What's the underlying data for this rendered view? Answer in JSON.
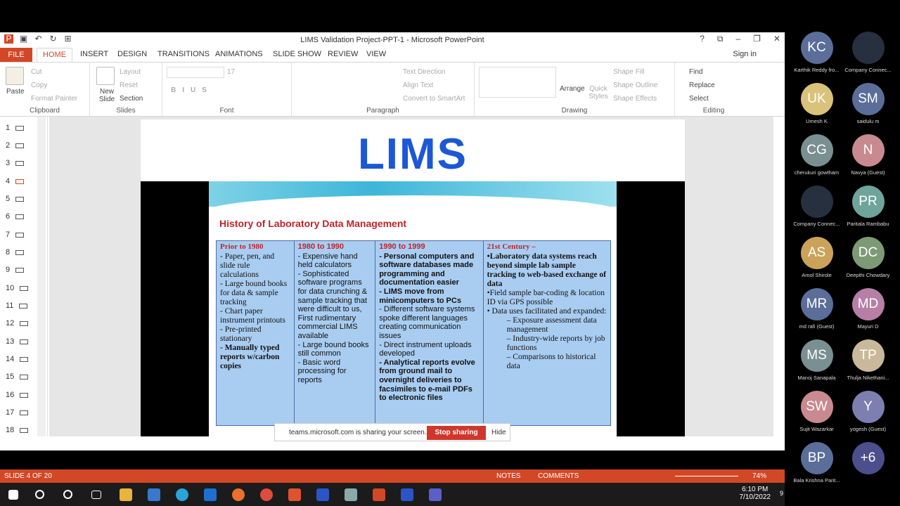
{
  "window": {
    "title": "LIMS Validation Project-PPT-1 - Microsoft PowerPoint",
    "signin": "Sign in"
  },
  "tabs": [
    "FILE",
    "HOME",
    "INSERT",
    "DESIGN",
    "TRANSITIONS",
    "ANIMATIONS",
    "SLIDE SHOW",
    "REVIEW",
    "VIEW"
  ],
  "ribbon": {
    "paste": "Paste",
    "cut": "Cut",
    "copy": "Copy",
    "format_painter": "Format Painter",
    "clipboard": "Clipboard",
    "new_slide": "New Slide",
    "layout": "Layout",
    "reset": "Reset",
    "section": "Section",
    "slides": "Slides",
    "font_size": "17",
    "font": "Font",
    "text_direction": "Text Direction",
    "align_text": "Align Text",
    "convert_smartart": "Convert to SmartArt",
    "paragraph": "Paragraph",
    "arrange": "Arrange",
    "quick_styles": "Quick Styles",
    "shape_fill": "Shape Fill",
    "shape_outline": "Shape Outline",
    "shape_effects": "Shape Effects",
    "drawing": "Drawing",
    "find": "Find",
    "replace": "Replace",
    "select": "Select",
    "editing": "Editing"
  },
  "thumbs": [
    "1",
    "2",
    "3",
    "4",
    "5",
    "6",
    "7",
    "8",
    "9",
    "10",
    "11",
    "12",
    "13",
    "14",
    "15",
    "16",
    "17",
    "18"
  ],
  "slide": {
    "heading": "LIMS",
    "title": "History of Laboratory Data Management",
    "col1": {
      "head": "Prior to 1980",
      "items": [
        "- Paper, pen, and slide rule calculations",
        "- Large bound books for data & sample tracking",
        "- Chart paper instrument printouts",
        "- Pre-printed stationary",
        "- Manually typed reports w/carbon copies"
      ]
    },
    "col2": {
      "head": "1980 to 1990",
      "items": [
        "- Expensive hand held calculators",
        "- Sophisticated software programs for data crunching & sample tracking that were difficult to us, First rudimentary commercial LIMS available",
        "- Large bound books still common",
        "- Basic word processing for reports"
      ]
    },
    "col3": {
      "head": "1990 to 1999",
      "items": [
        "- Personal computers and software databases made programming and documentation easier",
        "- LIMS move from minicomputers to PCs",
        "- Different software systems spoke different languages creating communication issues",
        "- Direct instrument uploads developed",
        "- Analytical reports evolve from ground mail to overnight deliveries to facsimiles to e-mail PDFs to electronic files"
      ]
    },
    "col4": {
      "head": "21st Century –",
      "items": [
        "•Laboratory data systems reach beyond simple lab sample tracking to web-based exchange of data",
        "•Field sample bar-coding & location ID via GPS possible",
        "• Data uses facilitated and expanded:",
        "– Exposure assessment data management",
        "– Industry-wide reports by job functions",
        "– Comparisons to historical data"
      ]
    }
  },
  "share": {
    "text": "teams.microsoft.com is sharing your screen.",
    "stop": "Stop sharing",
    "hide": "Hide"
  },
  "status": {
    "slide": "SLIDE 4 OF 20",
    "notes": "NOTES",
    "comments": "COMMENTS",
    "zoom": "74%"
  },
  "tray": {
    "time": "6:10 PM",
    "date": "7/10/2022",
    "badge": "9"
  },
  "participants": [
    {
      "init": "KC",
      "name": "Karthik Reddy fro...",
      "color": "#5b6d99"
    },
    {
      "init": "",
      "name": "Company Connec...",
      "color": "#26303f"
    },
    {
      "init": "UK",
      "name": "Umesh K",
      "color": "#d9c27a"
    },
    {
      "init": "SM",
      "name": "saidulu m",
      "color": "#5b6d99"
    },
    {
      "init": "CG",
      "name": "cherukuri gowtham",
      "color": "#7a8f92"
    },
    {
      "init": "N",
      "name": "Navya (Guest)",
      "color": "#c98a8f"
    },
    {
      "init": "",
      "name": "Company Connec...",
      "color": "#26303f"
    },
    {
      "init": "PR",
      "name": "Paritala Rambabu",
      "color": "#6fa49a"
    },
    {
      "init": "AS",
      "name": "Amol Shirole",
      "color": "#cca25a"
    },
    {
      "init": "DC",
      "name": "Deepthi Chowdary",
      "color": "#7d9a77"
    },
    {
      "init": "MR",
      "name": "md rafi (Guest)",
      "color": "#5b6d99"
    },
    {
      "init": "MD",
      "name": "Mayuri D",
      "color": "#b77fa6"
    },
    {
      "init": "MS",
      "name": "Manoj Sanapala",
      "color": "#7a8f92"
    },
    {
      "init": "TP",
      "name": "Thulja Nikethani...",
      "color": "#c9b99a"
    },
    {
      "init": "SW",
      "name": "Sujit Wazarkar",
      "color": "#c98a8f"
    },
    {
      "init": "Y",
      "name": "yogesh (Guest)",
      "color": "#7c7fb0"
    },
    {
      "init": "BP",
      "name": "Bala Krishna Parit...",
      "color": "#5b6d99"
    },
    {
      "init": "+6",
      "name": "",
      "color": "#4b4f8c"
    }
  ]
}
